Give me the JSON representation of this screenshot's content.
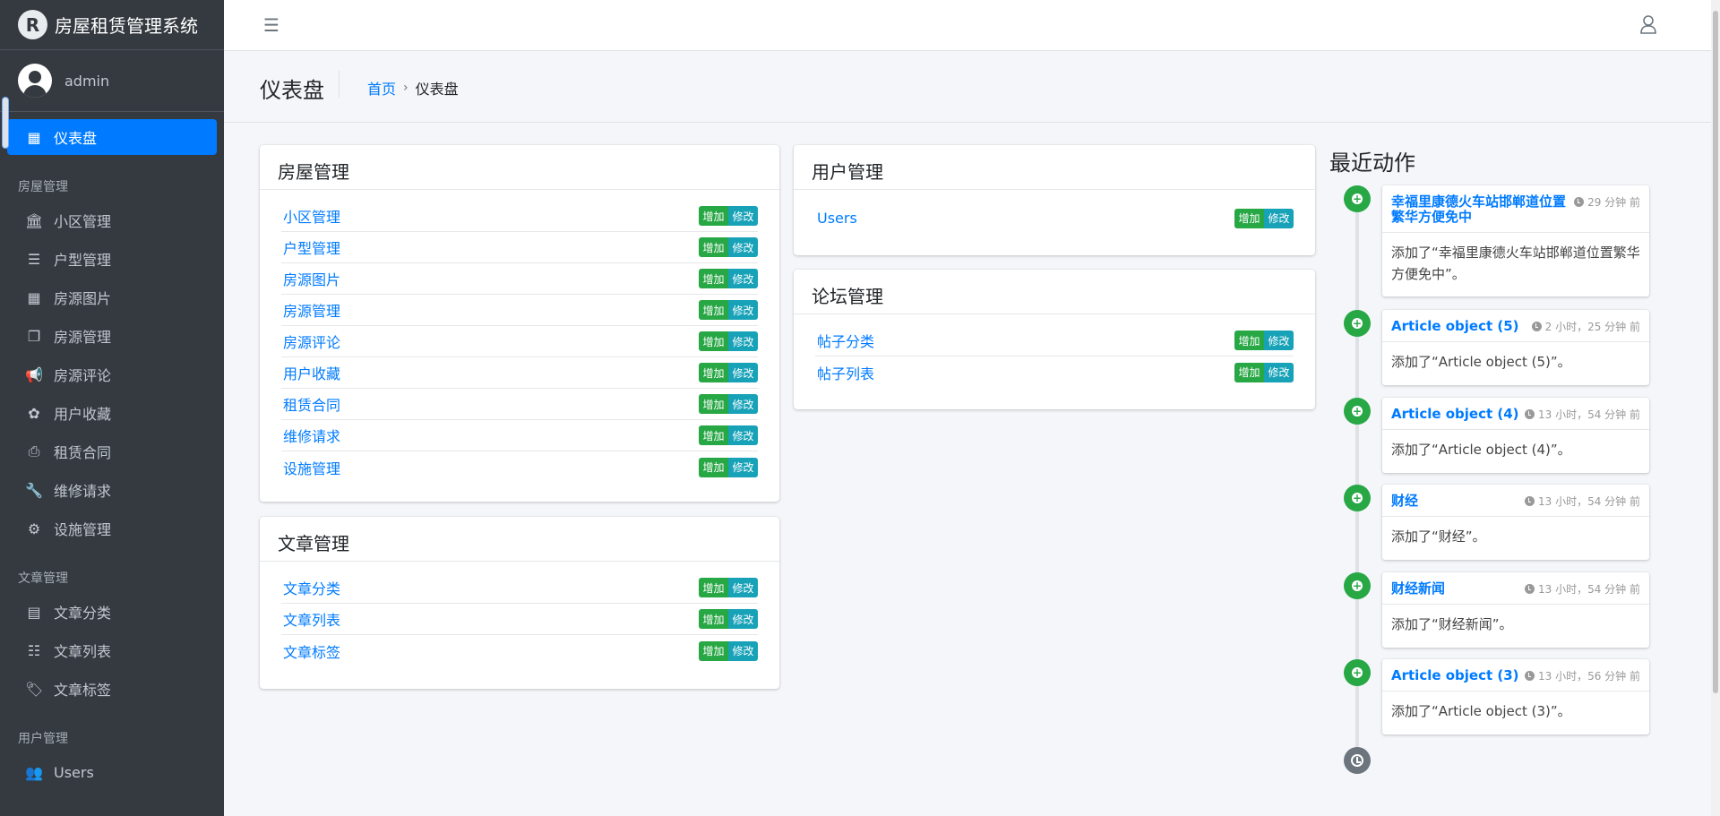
{
  "brand": {
    "logo": "R",
    "title": "房屋租赁管理系统"
  },
  "user": {
    "name": "admin"
  },
  "sidebar": {
    "dashboard": {
      "label": "仪表盘",
      "icon": "dashboard-icon"
    },
    "sections": [
      {
        "header": "房屋管理",
        "items": [
          {
            "label": "小区管理",
            "icon": "bank-icon",
            "glyph": "🏛"
          },
          {
            "label": "户型管理",
            "icon": "bars-icon",
            "glyph": "☰"
          },
          {
            "label": "房源图片",
            "icon": "grid-icon",
            "glyph": "▦"
          },
          {
            "label": "房源管理",
            "icon": "clone-icon",
            "glyph": "❐"
          },
          {
            "label": "房源评论",
            "icon": "bullhorn-icon",
            "glyph": "📢"
          },
          {
            "label": "用户收藏",
            "icon": "cubes-icon",
            "glyph": "✿"
          },
          {
            "label": "租赁合同",
            "icon": "print-icon",
            "glyph": "⎙"
          },
          {
            "label": "维修请求",
            "icon": "wrench-icon",
            "glyph": "🔧"
          },
          {
            "label": "设施管理",
            "icon": "gear-icon",
            "glyph": "⚙"
          }
        ]
      },
      {
        "header": "文章管理",
        "items": [
          {
            "label": "文章分类",
            "icon": "list-alt-icon",
            "glyph": "▤"
          },
          {
            "label": "文章列表",
            "icon": "list-icon",
            "glyph": "☷"
          },
          {
            "label": "文章标签",
            "icon": "tags-icon",
            "glyph": "🏷"
          }
        ]
      },
      {
        "header": "用户管理",
        "items": [
          {
            "label": "Users",
            "icon": "users-icon",
            "glyph": "👥"
          }
        ]
      }
    ]
  },
  "header": {
    "title": "仪表盘",
    "breadcrumb_home": "首页",
    "breadcrumb_sep": "›",
    "breadcrumb_current": "仪表盘"
  },
  "buttons": {
    "add": "增加",
    "modify": "修改"
  },
  "cards": {
    "house": {
      "title": "房屋管理",
      "rows": [
        "小区管理",
        "户型管理",
        "房源图片",
        "房源管理",
        "房源评论",
        "用户收藏",
        "租赁合同",
        "维修请求",
        "设施管理"
      ]
    },
    "article": {
      "title": "文章管理",
      "rows": [
        "文章分类",
        "文章列表",
        "文章标签"
      ]
    },
    "user": {
      "title": "用户管理",
      "rows": [
        "Users"
      ]
    },
    "forum": {
      "title": "论坛管理",
      "rows": [
        "帖子分类",
        "帖子列表"
      ]
    }
  },
  "recent": {
    "title": "最近动作",
    "items": [
      {
        "title": "幸福里康德火车站邯郸道位置繁华方便免中",
        "time": "29 分钟 前",
        "body": "添加了“幸福里康德火车站邯郸道位置繁华方便免中”。"
      },
      {
        "title": "Article object (5)",
        "time": "2 小时，25 分钟 前",
        "body": "添加了“Article object (5)”。"
      },
      {
        "title": "Article object (4)",
        "time": "13 小时，54 分钟 前",
        "body": "添加了“Article object (4)”。"
      },
      {
        "title": "财经",
        "time": "13 小时，54 分钟 前",
        "body": "添加了“财经”。"
      },
      {
        "title": "财经新闻",
        "time": "13 小时，54 分钟 前",
        "body": "添加了“财经新闻”。"
      },
      {
        "title": "Article object (3)",
        "time": "13 小时，56 分钟 前",
        "body": "添加了“Article object (3)”。"
      }
    ]
  }
}
